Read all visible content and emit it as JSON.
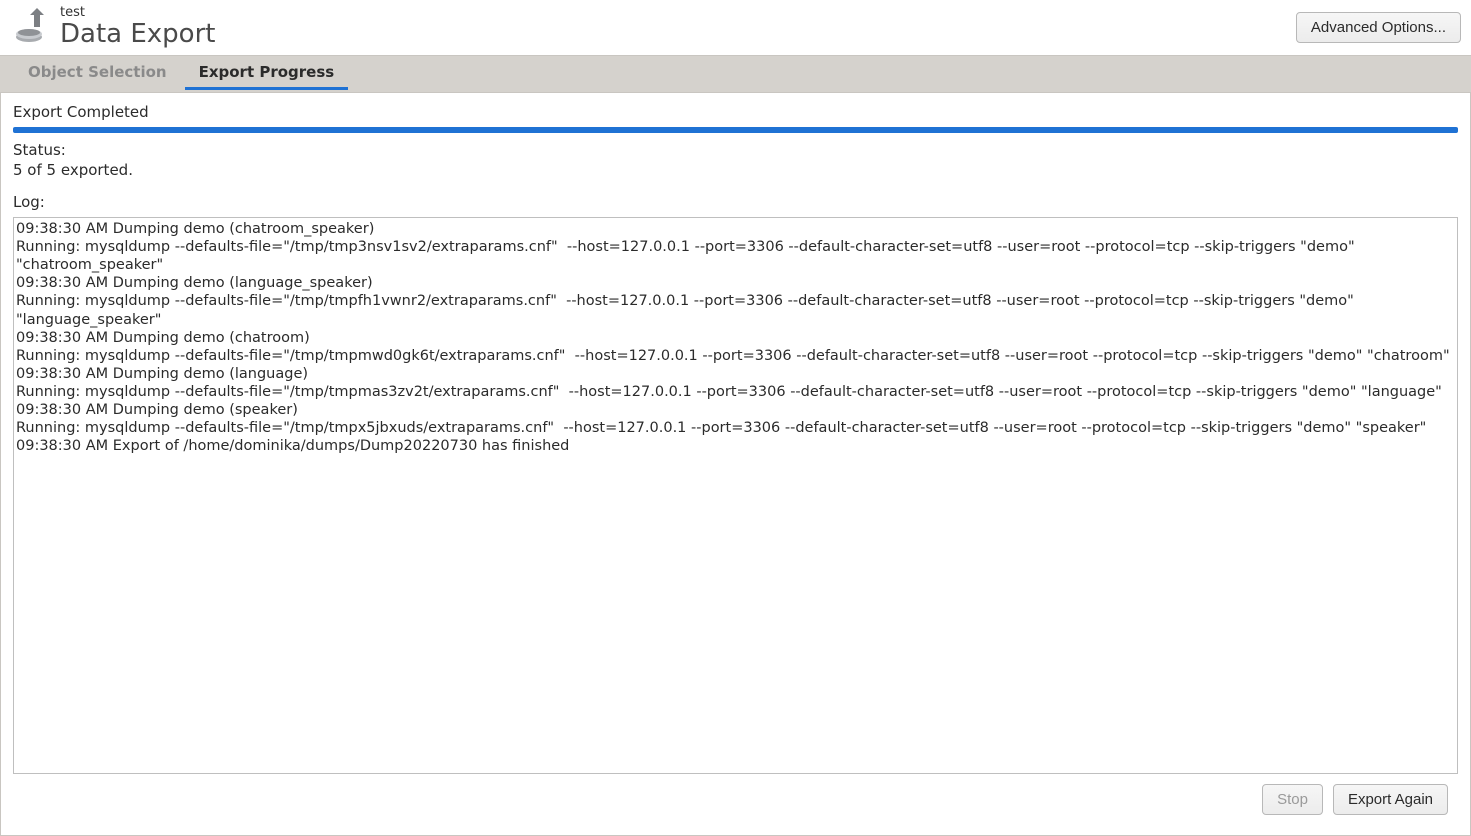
{
  "header": {
    "subtitle": "test",
    "title": "Data Export",
    "advanced_label": "Advanced Options..."
  },
  "tabs": {
    "object_selection": "Object Selection",
    "export_progress": "Export Progress",
    "active": "export_progress"
  },
  "progress": {
    "title": "Export Completed",
    "percent": 100,
    "status_label": "Status:",
    "status_value": "5 of 5 exported.",
    "log_label": "Log:"
  },
  "log_lines": [
    "09:38:30 AM Dumping demo (chatroom_speaker)",
    "Running: mysqldump --defaults-file=\"/tmp/tmp3nsv1sv2/extraparams.cnf\"  --host=127.0.0.1 --port=3306 --default-character-set=utf8 --user=root --protocol=tcp --skip-triggers \"demo\" \"chatroom_speaker\"",
    "09:38:30 AM Dumping demo (language_speaker)",
    "Running: mysqldump --defaults-file=\"/tmp/tmpfh1vwnr2/extraparams.cnf\"  --host=127.0.0.1 --port=3306 --default-character-set=utf8 --user=root --protocol=tcp --skip-triggers \"demo\" \"language_speaker\"",
    "09:38:30 AM Dumping demo (chatroom)",
    "Running: mysqldump --defaults-file=\"/tmp/tmpmwd0gk6t/extraparams.cnf\"  --host=127.0.0.1 --port=3306 --default-character-set=utf8 --user=root --protocol=tcp --skip-triggers \"demo\" \"chatroom\"",
    "09:38:30 AM Dumping demo (language)",
    "Running: mysqldump --defaults-file=\"/tmp/tmpmas3zv2t/extraparams.cnf\"  --host=127.0.0.1 --port=3306 --default-character-set=utf8 --user=root --protocol=tcp --skip-triggers \"demo\" \"language\"",
    "09:38:30 AM Dumping demo (speaker)",
    "Running: mysqldump --defaults-file=\"/tmp/tmpx5jbxuds/extraparams.cnf\"  --host=127.0.0.1 --port=3306 --default-character-set=utf8 --user=root --protocol=tcp --skip-triggers \"demo\" \"speaker\"",
    "09:38:30 AM Export of /home/dominika/dumps/Dump20220730 has finished"
  ],
  "footer": {
    "stop_label": "Stop",
    "stop_disabled": true,
    "export_again_label": "Export Again"
  }
}
